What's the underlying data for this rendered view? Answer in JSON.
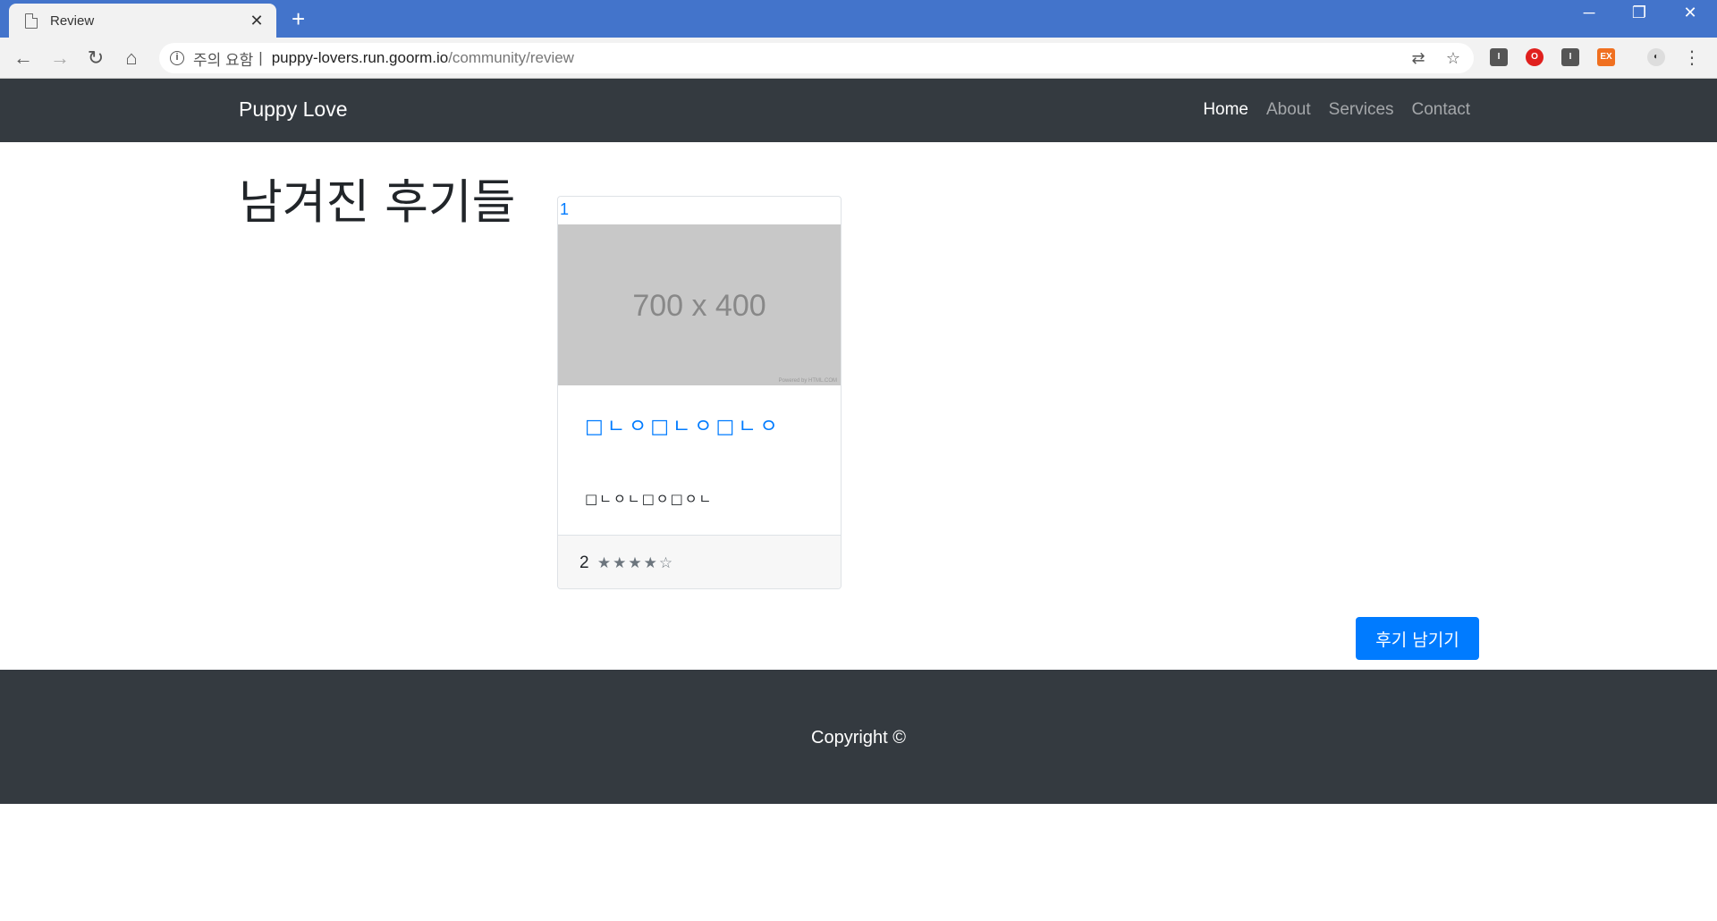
{
  "browser": {
    "tab_title": "Review",
    "new_tab": "+",
    "security_label": "주의 요함",
    "separator": "|",
    "url_host": "puppy-lovers.run.goorm.io",
    "url_path": "/community/review"
  },
  "navbar": {
    "brand": "Puppy Love",
    "links": [
      "Home",
      "About",
      "Services",
      "Contact"
    ],
    "active": "Home"
  },
  "main": {
    "heading": "남겨진 후기들",
    "card": {
      "link": "1",
      "image_text": "700 x 400",
      "image_credit": "Powered by HTML.COM",
      "title": "□ㄴㅇ□ㄴㅇ□ㄴㅇ",
      "text": "□ㄴㅇㄴ□ㅇ□ㅇㄴ",
      "footer_number": "2",
      "stars": "★★★★☆",
      "rating": 4
    },
    "write_button": "후기 남기기"
  },
  "footer": {
    "copyright": "Copyright ©"
  },
  "colors": {
    "tabstrip": "#4374cb",
    "navbar": "#343a40",
    "primary": "#007bff"
  }
}
